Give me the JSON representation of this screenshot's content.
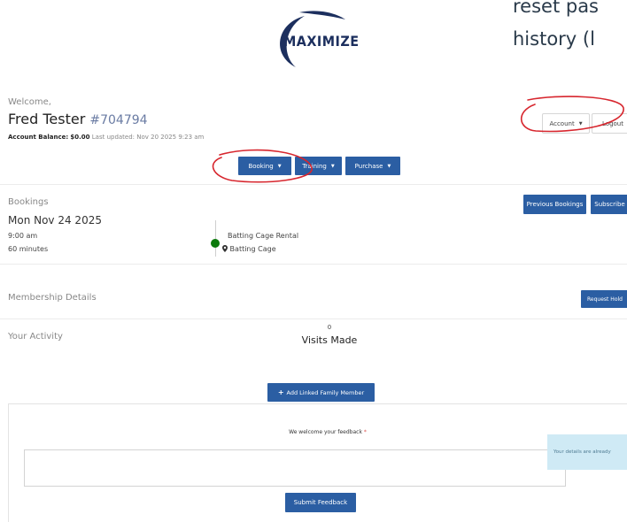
{
  "overlay": {
    "line1": "reset pas",
    "line2": "history (l"
  },
  "logo": {
    "text": "MAXIMIZE"
  },
  "header": {
    "welcome": "Welcome,",
    "name": "Fred Tester",
    "member_id": "#704794",
    "balance_label": "Account Balance:",
    "balance_value": "$0.00",
    "last_updated": "Last updated: Nov 20 2025 9:23 am",
    "account_label": "Account",
    "logout_label": "Logout"
  },
  "nav": {
    "booking": "Booking",
    "training": "Training",
    "purchase": "Purchase"
  },
  "bookings": {
    "title": "Bookings",
    "previous_label": "Previous Bookings",
    "subscribe_label": "Subscribe",
    "date": "Mon Nov 24 2025",
    "time": "9:00 am",
    "duration": "60 minutes",
    "activity": "Batting Cage Rental",
    "location": "Batting Cage"
  },
  "membership": {
    "title": "Membership Details",
    "request_hold_label": "Request Hold"
  },
  "activity": {
    "title": "Your Activity",
    "visits_count": "0",
    "visits_label": "Visits Made",
    "add_family_label": "Add Linked Family Member"
  },
  "feedback": {
    "label": "We welcome your feedback",
    "required_mark": "*",
    "submit_label": "Submit Feedback",
    "info_text": "Your details are already"
  },
  "colors": {
    "primary_button": "#2b5ea3",
    "logo_navy": "#1c2f5e",
    "status_dot": "#0b7a0b",
    "annotation_red": "#d7262e",
    "info_bg": "#cfeaf5"
  }
}
